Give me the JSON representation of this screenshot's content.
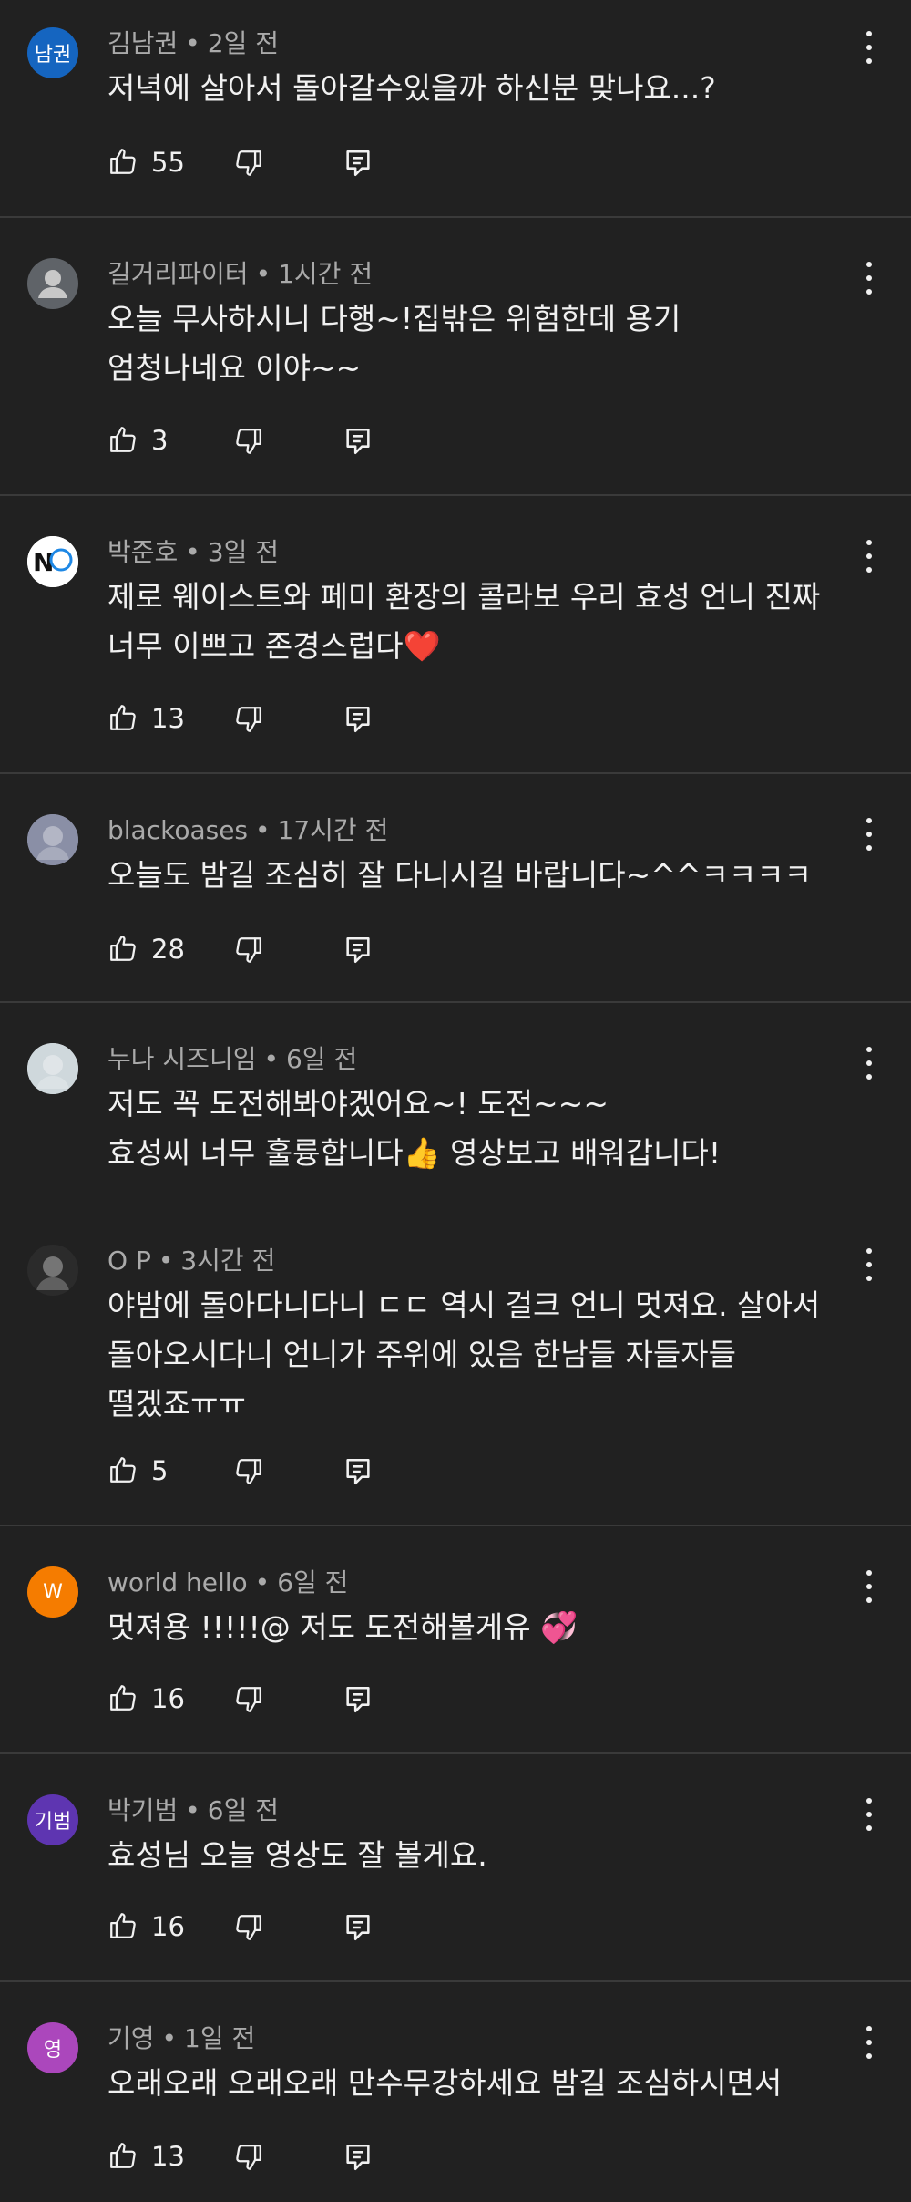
{
  "comments": [
    {
      "author": "김남권",
      "time": "2일 전",
      "text": "저녁에 살아서 돌아갈수있을까 하신분 맞나요...?",
      "likes": "55",
      "avatar": {
        "type": "text",
        "label": "남권",
        "color": "#1565c0"
      }
    },
    {
      "author": "길거리파이터",
      "time": "1시간 전",
      "text": "오늘 무사하시니 다행~!집밖은 위험한데 용기\n엄청나네요 이야~~",
      "likes": "3",
      "avatar": {
        "type": "default-person",
        "color": "#5f6368"
      }
    },
    {
      "author": "박준호",
      "time": "3일 전",
      "text": "제로 웨이스트와 페미 환장의 콜라보 우리 효성 언니 진짜\n너무 이쁘고 존경스럽다❤️",
      "likes": "13",
      "avatar": {
        "type": "logo",
        "label": "NO",
        "color": "#ffffff"
      }
    },
    {
      "author": "blackoases",
      "time": "17시간 전",
      "text": "오늘도 밤길 조심히 잘 다니시길 바랍니다~^^ㅋㅋㅋㅋ",
      "likes": "28",
      "avatar": {
        "type": "photo",
        "color": "#8a8fa6"
      }
    },
    {
      "author": "누나 시즈니임",
      "time": "6일 전",
      "text": "저도 꼭 도전해봐야겠어요~! 도전~~~\n효성씨 너무 훌륭합니다👍 영상보고 배워갑니다!",
      "likes": "",
      "avatar": {
        "type": "photo",
        "color": "#cfd8dc"
      }
    },
    {
      "author": "O P",
      "time": "3시간 전",
      "text": "야밤에 돌아다니다니 ㄷㄷ 역시 걸크 언니 멋져요. 살아서\n돌아오시다니 언니가 주위에 있음 한남들 자들자들\n떨겠죠ㅠㅠ",
      "likes": "5",
      "avatar": {
        "type": "photo",
        "color": "#2b2b2b"
      }
    },
    {
      "author": "world hello",
      "time": "6일 전",
      "text": "멋져용 !!!!!@ 저도 도전해볼게유 💞",
      "likes": "16",
      "avatar": {
        "type": "text",
        "label": "W",
        "color": "#f57c00"
      }
    },
    {
      "author": "박기범",
      "time": "6일 전",
      "text": "효성님 오늘 영상도 잘 볼게요.",
      "likes": "16",
      "avatar": {
        "type": "text",
        "label": "기범",
        "color": "#5e35b1"
      }
    },
    {
      "author": "기영",
      "time": "1일 전",
      "text": "오래오래 오래오래 만수무강하세요 밤길 조심하시면서",
      "likes": "13",
      "avatar": {
        "type": "text",
        "label": "영",
        "color": "#ab47bc"
      }
    }
  ],
  "icons": {
    "like": "thumbs-up-icon",
    "dislike": "thumbs-down-icon",
    "reply": "reply-icon",
    "more": "more-vert-icon"
  }
}
